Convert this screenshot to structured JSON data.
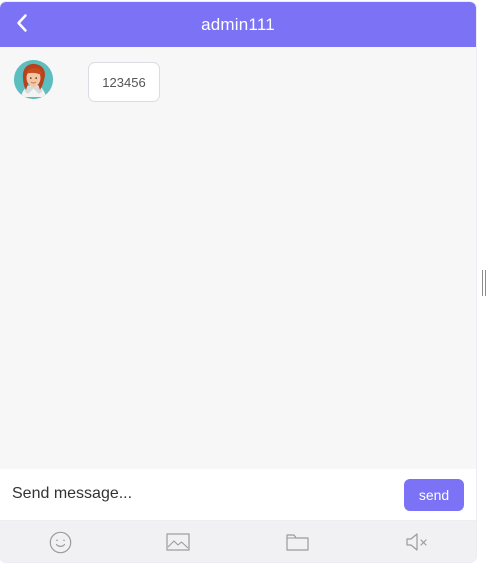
{
  "chat": {
    "title": "admin111",
    "back_icon": "chevron-left-icon",
    "messages": [
      {
        "sender_avatar": "user-avatar",
        "text": "123456"
      }
    ]
  },
  "composer": {
    "placeholder": "Send message...",
    "send_label": "send"
  },
  "toolbar": {
    "tools": [
      {
        "icon": "emoji-icon"
      },
      {
        "icon": "image-icon"
      },
      {
        "icon": "folder-icon"
      },
      {
        "icon": "mute-icon"
      }
    ]
  },
  "theme": {
    "accent": "#7b72f6",
    "background": "#f7f7f8",
    "toolbar": "#f1f1f4"
  }
}
